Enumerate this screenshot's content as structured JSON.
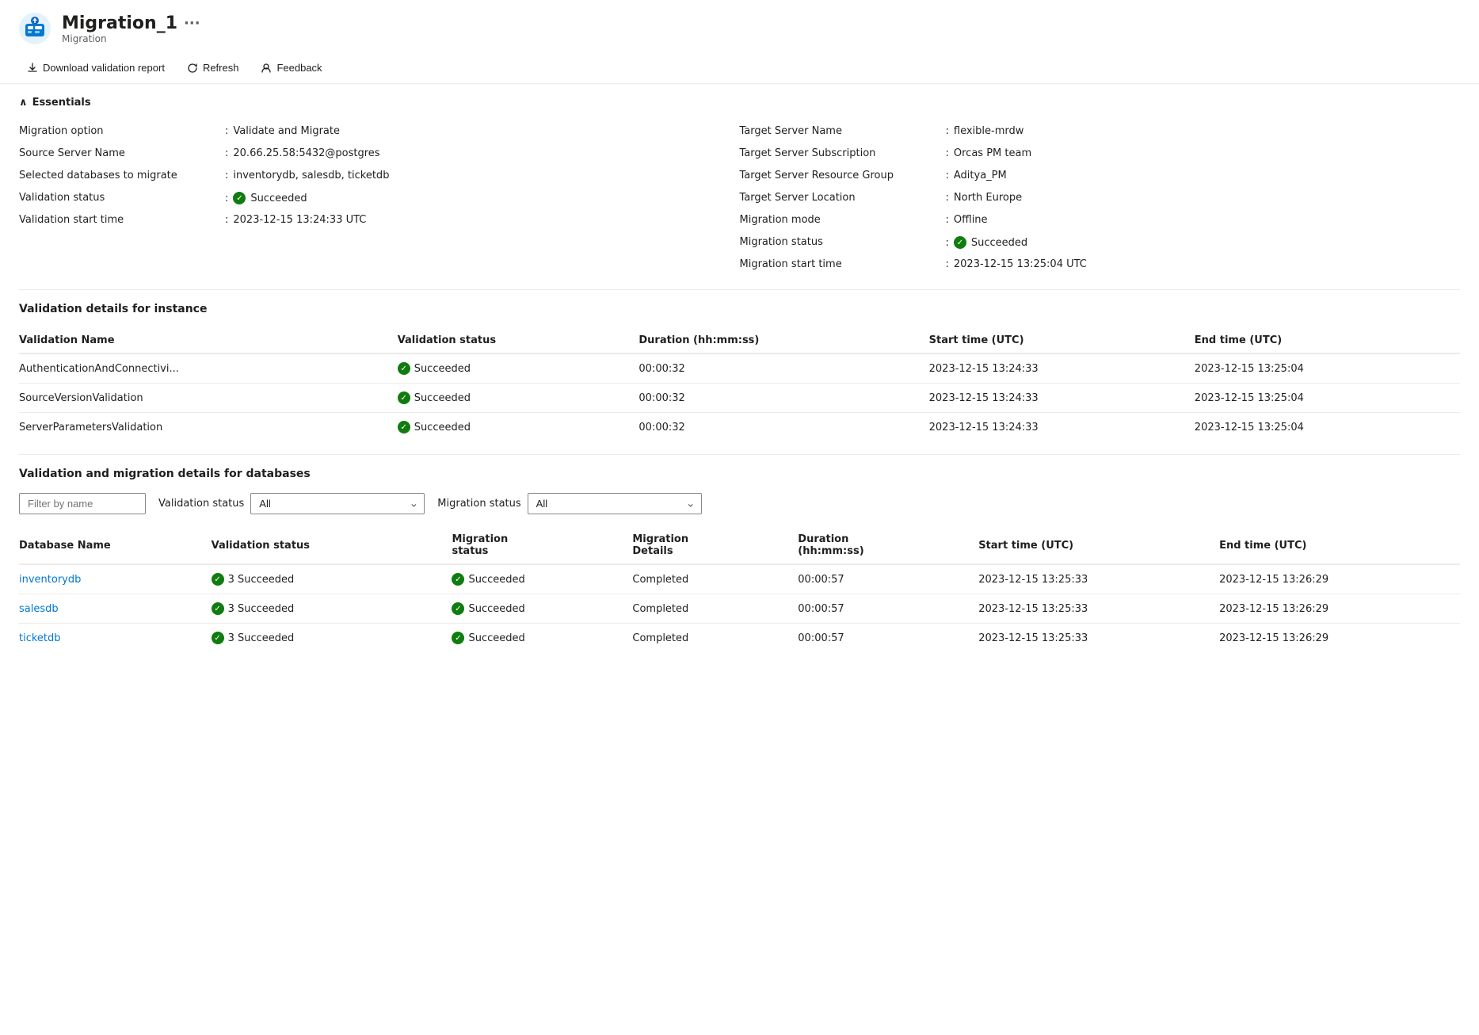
{
  "header": {
    "title": "Migration_1",
    "subtitle": "Migration",
    "ellipsis": "···"
  },
  "toolbar": {
    "download_label": "Download validation report",
    "refresh_label": "Refresh",
    "feedback_label": "Feedback"
  },
  "essentials": {
    "section_label": "Essentials",
    "left": [
      {
        "label": "Migration option",
        "value": "Validate and Migrate"
      },
      {
        "label": "Source Server Name",
        "value": "20.66.25.58:5432@postgres"
      },
      {
        "label": "Selected databases to migrate",
        "value": "inventorydb, salesdb, ticketdb"
      },
      {
        "label": "Validation status",
        "value": "Succeeded",
        "is_status": true
      },
      {
        "label": "Validation start time",
        "value": "2023-12-15 13:24:33 UTC"
      }
    ],
    "right": [
      {
        "label": "Target Server Name",
        "value": "flexible-mrdw"
      },
      {
        "label": "Target Server Subscription",
        "value": "Orcas PM team"
      },
      {
        "label": "Target Server Resource Group",
        "value": "Aditya_PM"
      },
      {
        "label": "Target Server Location",
        "value": "North Europe"
      },
      {
        "label": "Migration mode",
        "value": "Offline"
      },
      {
        "label": "Migration status",
        "value": "Succeeded",
        "is_status": true
      },
      {
        "label": "Migration start time",
        "value": "2023-12-15 13:25:04 UTC"
      }
    ]
  },
  "validation_instance": {
    "section_title": "Validation details for instance",
    "columns": [
      "Validation Name",
      "Validation status",
      "Duration (hh:mm:ss)",
      "Start time (UTC)",
      "End time (UTC)"
    ],
    "rows": [
      {
        "name": "AuthenticationAndConnectivi...",
        "status": "Succeeded",
        "duration": "00:00:32",
        "start": "2023-12-15 13:24:33",
        "end": "2023-12-15 13:25:04"
      },
      {
        "name": "SourceVersionValidation",
        "status": "Succeeded",
        "duration": "00:00:32",
        "start": "2023-12-15 13:24:33",
        "end": "2023-12-15 13:25:04"
      },
      {
        "name": "ServerParametersValidation",
        "status": "Succeeded",
        "duration": "00:00:32",
        "start": "2023-12-15 13:24:33",
        "end": "2023-12-15 13:25:04"
      }
    ]
  },
  "validation_databases": {
    "section_title": "Validation and migration details for databases",
    "filter_placeholder": "Filter by name",
    "validation_status_label": "Validation status",
    "migration_status_label": "Migration status",
    "filter_options_validation": [
      "All"
    ],
    "filter_options_migration": [
      "All"
    ],
    "filter_default": "All",
    "columns": [
      "Database Name",
      "Validation status",
      "Migration status",
      "Migration Details",
      "Duration (hh:mm:ss)",
      "Start time (UTC)",
      "End time (UTC)"
    ],
    "rows": [
      {
        "name": "inventorydb",
        "validation_status": "3 Succeeded",
        "migration_status": "Succeeded",
        "migration_details": "Completed",
        "duration": "00:00:57",
        "start": "2023-12-15 13:25:33",
        "end": "2023-12-15 13:26:29"
      },
      {
        "name": "salesdb",
        "validation_status": "3 Succeeded",
        "migration_status": "Succeeded",
        "migration_details": "Completed",
        "duration": "00:00:57",
        "start": "2023-12-15 13:25:33",
        "end": "2023-12-15 13:26:29"
      },
      {
        "name": "ticketdb",
        "validation_status": "3 Succeeded",
        "migration_status": "Succeeded",
        "migration_details": "Completed",
        "duration": "00:00:57",
        "start": "2023-12-15 13:25:33",
        "end": "2023-12-15 13:26:29"
      }
    ]
  }
}
